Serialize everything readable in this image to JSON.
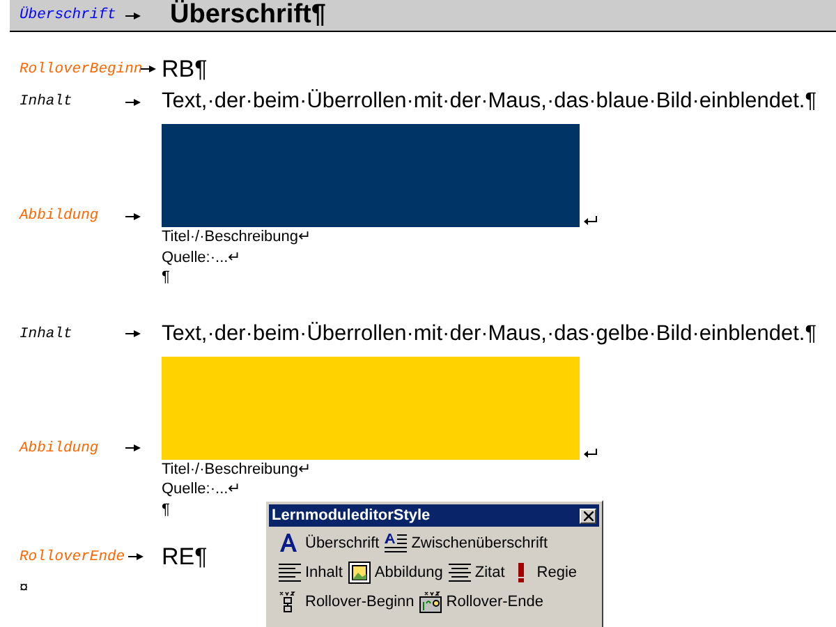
{
  "document": {
    "paragraphs": [
      {
        "kind": "heading",
        "style": "Überschrift",
        "color": "#0000ff",
        "text": "Überschrift¶"
      },
      {
        "kind": "marker",
        "style": "RolloverBeginn",
        "color": "#ff6600",
        "text": "RB¶"
      },
      {
        "kind": "text",
        "style": "Inhalt",
        "color": "#000000",
        "text": "Text,·der·beim·Überrollen·mit·der·Maus,·das·blaue·Bild·einblendet.¶"
      },
      {
        "kind": "figure",
        "style": "Abbildung",
        "color": "#ff6600",
        "image": {
          "color": "#003366"
        },
        "captions": [
          "Titel·/·Beschreibung↵",
          "Quelle:·...↵",
          "¶"
        ]
      },
      {
        "kind": "text",
        "style": "Inhalt",
        "color": "#000000",
        "text": "Text,·der·beim·Überrollen·mit·der·Maus,·das·gelbe·Bild·einblendet.¶"
      },
      {
        "kind": "figure",
        "style": "Abbildung",
        "color": "#ff6600",
        "image": {
          "color": "#ffd200"
        },
        "captions": [
          "Titel·/·Beschreibung↵",
          "Quelle:·...↵",
          "¶"
        ]
      },
      {
        "kind": "marker",
        "style": "RolloverEnde",
        "color": "#ff6600",
        "text": "RE¶"
      },
      {
        "kind": "end",
        "text": "¤"
      }
    ]
  },
  "toolbar": {
    "title": "LernmoduleditorStyle",
    "rows": [
      [
        {
          "kind": "heading",
          "label": "Überschrift"
        },
        {
          "kind": "subheading",
          "label": "Zwischenüberschrift"
        }
      ],
      [
        {
          "kind": "content",
          "label": "Inhalt"
        },
        {
          "kind": "figure",
          "label": "Abbildung"
        },
        {
          "kind": "quote",
          "label": "Zitat"
        },
        {
          "kind": "direction",
          "label": "Regie"
        }
      ],
      [
        {
          "kind": "rollover-begin",
          "label": "Rollover-Beginn"
        },
        {
          "kind": "rollover-end",
          "label": "Rollover-Ende"
        }
      ]
    ]
  }
}
